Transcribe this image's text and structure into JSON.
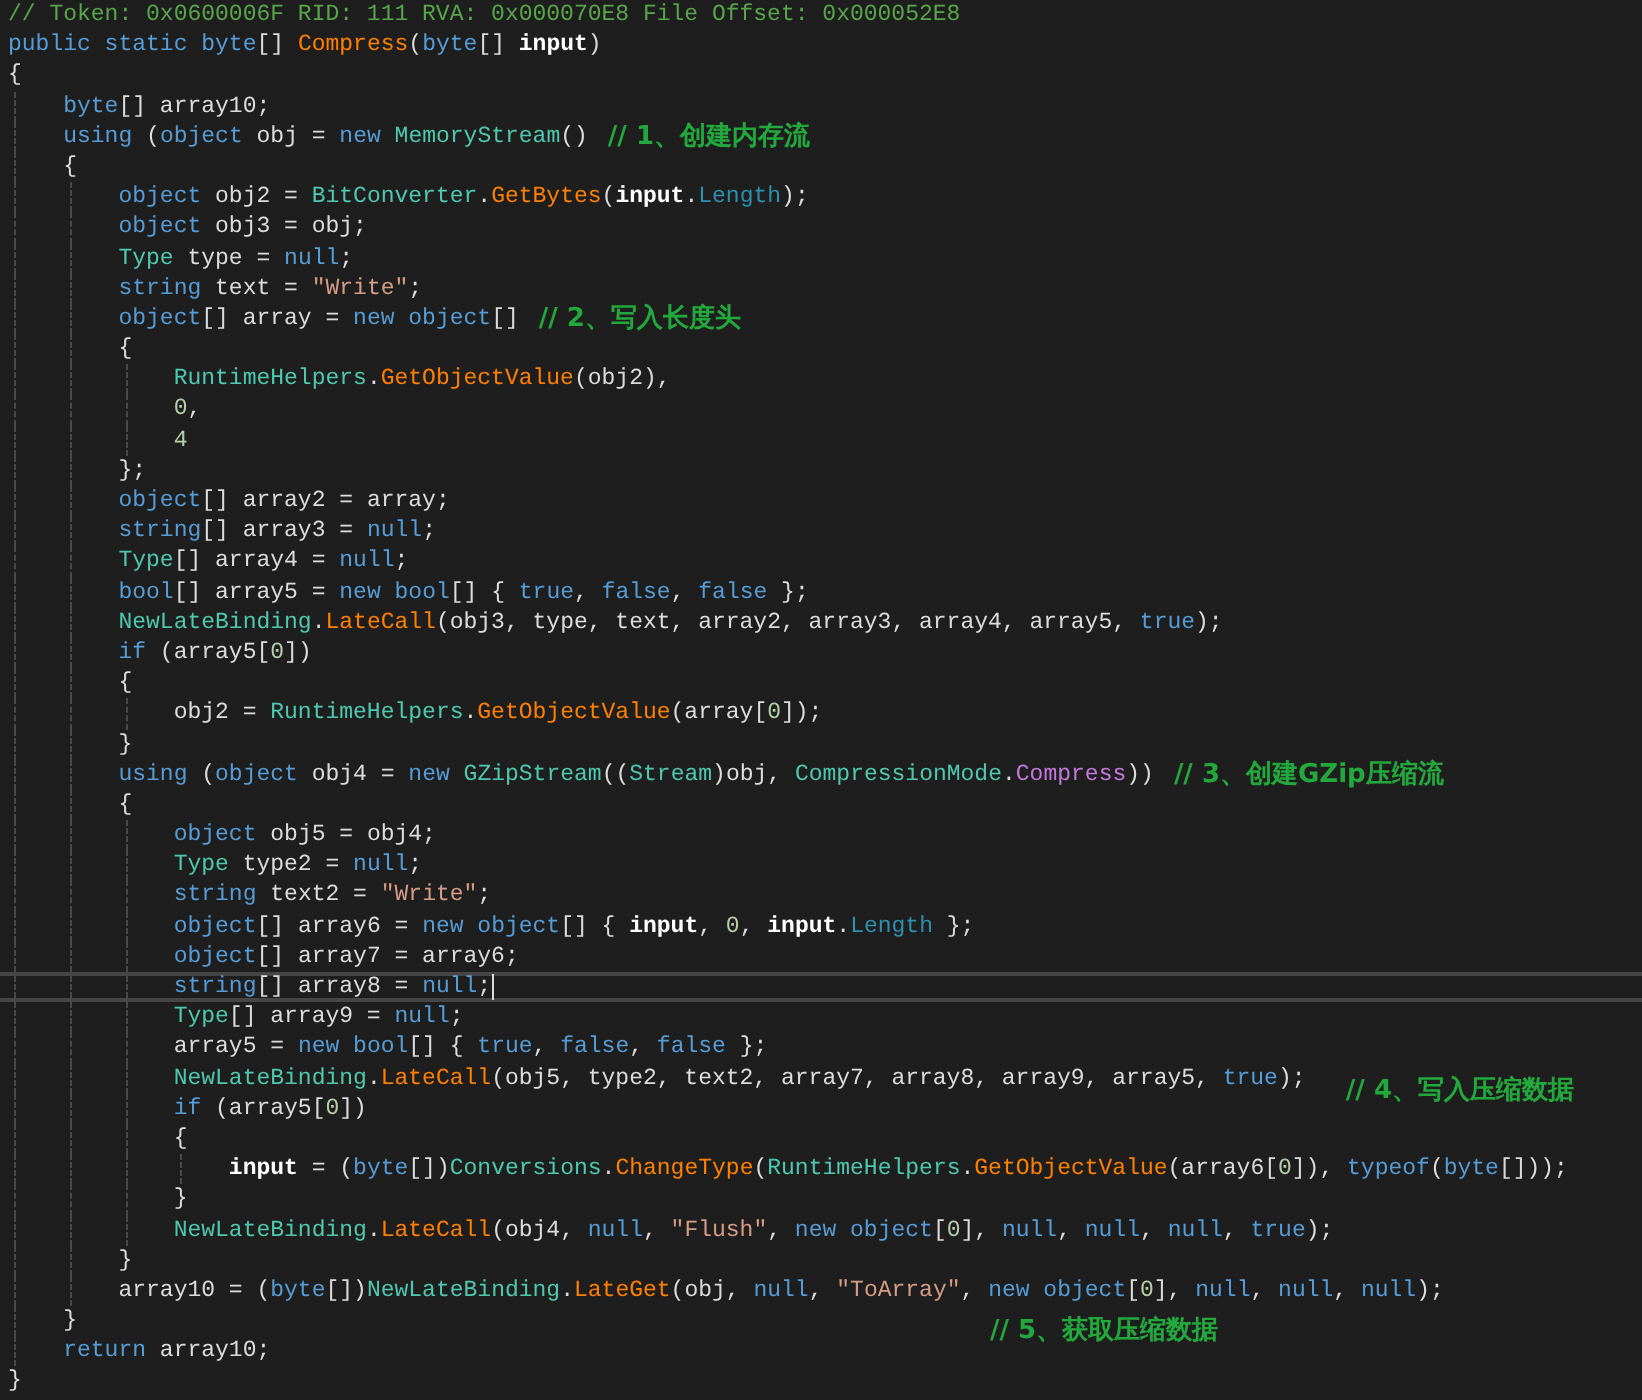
{
  "editor": {
    "lines": [
      {
        "current": false,
        "tokens": [
          {
            "kind": "comment",
            "text": "// Token: 0x0600006F RID: 111 RVA: 0x000070E8 File Offset: 0x000052E8"
          }
        ]
      },
      {
        "current": false,
        "tokens": [
          {
            "kind": "keyword",
            "text": "public static byte"
          },
          {
            "kind": "plain",
            "text": "[] "
          },
          {
            "kind": "method",
            "text": "Compress"
          },
          {
            "kind": "plain",
            "text": "("
          },
          {
            "kind": "keyword",
            "text": "byte"
          },
          {
            "kind": "plain",
            "text": "[] "
          },
          {
            "kind": "param",
            "text": "input"
          },
          {
            "kind": "plain",
            "text": ")"
          }
        ]
      },
      {
        "current": false,
        "tokens": [
          {
            "kind": "plain",
            "text": "{"
          }
        ]
      },
      {
        "current": false,
        "tokens": [
          {
            "kind": "keyword",
            "text": "    byte"
          },
          {
            "kind": "plain",
            "text": "[] array10;"
          }
        ]
      },
      {
        "current": false,
        "tokens": [
          {
            "kind": "keyword",
            "text": "    using"
          },
          {
            "kind": "plain",
            "text": " ("
          },
          {
            "kind": "keyword",
            "text": "object"
          },
          {
            "kind": "plain",
            "text": " obj = "
          },
          {
            "kind": "keyword",
            "text": "new"
          },
          {
            "kind": "type",
            "text": " MemoryStream"
          },
          {
            "kind": "plain",
            "text": "()"
          }
        ],
        "note": {
          "text": "// 1、创建内存流",
          "kind": "inline"
        }
      },
      {
        "current": false,
        "tokens": [
          {
            "kind": "plain",
            "text": "    {"
          }
        ]
      },
      {
        "current": false,
        "tokens": [
          {
            "kind": "keyword",
            "text": "        object"
          },
          {
            "kind": "plain",
            "text": " obj2 = "
          },
          {
            "kind": "type",
            "text": "BitConverter"
          },
          {
            "kind": "plain",
            "text": "."
          },
          {
            "kind": "method",
            "text": "GetBytes"
          },
          {
            "kind": "plain",
            "text": "("
          },
          {
            "kind": "param",
            "text": "input"
          },
          {
            "kind": "plain",
            "text": "."
          },
          {
            "kind": "member",
            "text": "Length"
          },
          {
            "kind": "plain",
            "text": ");"
          }
        ]
      },
      {
        "current": false,
        "tokens": [
          {
            "kind": "keyword",
            "text": "        object"
          },
          {
            "kind": "plain",
            "text": " obj3 = obj;"
          }
        ]
      },
      {
        "current": false,
        "tokens": [
          {
            "kind": "type",
            "text": "        Type"
          },
          {
            "kind": "plain",
            "text": " type = "
          },
          {
            "kind": "keyword",
            "text": "null"
          },
          {
            "kind": "plain",
            "text": ";"
          }
        ]
      },
      {
        "current": false,
        "tokens": [
          {
            "kind": "keyword",
            "text": "        string"
          },
          {
            "kind": "plain",
            "text": " text = "
          },
          {
            "kind": "string",
            "text": "\"Write\""
          },
          {
            "kind": "plain",
            "text": ";"
          }
        ]
      },
      {
        "current": false,
        "tokens": [
          {
            "kind": "keyword",
            "text": "        object"
          },
          {
            "kind": "plain",
            "text": "[] array = "
          },
          {
            "kind": "keyword",
            "text": "new object"
          },
          {
            "kind": "plain",
            "text": "[]"
          }
        ],
        "note": {
          "text": "// 2、写入长度头",
          "kind": "inline"
        }
      },
      {
        "current": false,
        "tokens": [
          {
            "kind": "plain",
            "text": "        {"
          }
        ]
      },
      {
        "current": false,
        "tokens": [
          {
            "kind": "type",
            "text": "            RuntimeHelpers"
          },
          {
            "kind": "plain",
            "text": "."
          },
          {
            "kind": "method",
            "text": "GetObjectValue"
          },
          {
            "kind": "plain",
            "text": "(obj2),"
          }
        ]
      },
      {
        "current": false,
        "tokens": [
          {
            "kind": "number",
            "text": "            0"
          },
          {
            "kind": "plain",
            "text": ","
          }
        ]
      },
      {
        "current": false,
        "tokens": [
          {
            "kind": "number",
            "text": "            4"
          }
        ]
      },
      {
        "current": false,
        "tokens": [
          {
            "kind": "plain",
            "text": "        };"
          }
        ]
      },
      {
        "current": false,
        "tokens": [
          {
            "kind": "keyword",
            "text": "        object"
          },
          {
            "kind": "plain",
            "text": "[] array2 = array;"
          }
        ]
      },
      {
        "current": false,
        "tokens": [
          {
            "kind": "keyword",
            "text": "        string"
          },
          {
            "kind": "plain",
            "text": "[] array3 = "
          },
          {
            "kind": "keyword",
            "text": "null"
          },
          {
            "kind": "plain",
            "text": ";"
          }
        ]
      },
      {
        "current": false,
        "tokens": [
          {
            "kind": "type",
            "text": "        Type"
          },
          {
            "kind": "plain",
            "text": "[] array4 = "
          },
          {
            "kind": "keyword",
            "text": "null"
          },
          {
            "kind": "plain",
            "text": ";"
          }
        ]
      },
      {
        "current": false,
        "tokens": [
          {
            "kind": "keyword",
            "text": "        bool"
          },
          {
            "kind": "plain",
            "text": "[] array5 = "
          },
          {
            "kind": "keyword",
            "text": "new bool"
          },
          {
            "kind": "plain",
            "text": "[] { "
          },
          {
            "kind": "keyword",
            "text": "true"
          },
          {
            "kind": "plain",
            "text": ", "
          },
          {
            "kind": "keyword",
            "text": "false"
          },
          {
            "kind": "plain",
            "text": ", "
          },
          {
            "kind": "keyword",
            "text": "false"
          },
          {
            "kind": "plain",
            "text": " };"
          }
        ]
      },
      {
        "current": false,
        "tokens": [
          {
            "kind": "type",
            "text": "        NewLateBinding"
          },
          {
            "kind": "plain",
            "text": "."
          },
          {
            "kind": "method",
            "text": "LateCall"
          },
          {
            "kind": "plain",
            "text": "(obj3, type, text, array2, array3, array4, array5, "
          },
          {
            "kind": "keyword",
            "text": "true"
          },
          {
            "kind": "plain",
            "text": ");"
          }
        ]
      },
      {
        "current": false,
        "tokens": [
          {
            "kind": "keyword",
            "text": "        if"
          },
          {
            "kind": "plain",
            "text": " (array5["
          },
          {
            "kind": "number",
            "text": "0"
          },
          {
            "kind": "plain",
            "text": "])"
          }
        ]
      },
      {
        "current": false,
        "tokens": [
          {
            "kind": "plain",
            "text": "        {"
          }
        ]
      },
      {
        "current": false,
        "tokens": [
          {
            "kind": "plain",
            "text": "            obj2 = "
          },
          {
            "kind": "type",
            "text": "RuntimeHelpers"
          },
          {
            "kind": "plain",
            "text": "."
          },
          {
            "kind": "method",
            "text": "GetObjectValue"
          },
          {
            "kind": "plain",
            "text": "(array["
          },
          {
            "kind": "number",
            "text": "0"
          },
          {
            "kind": "plain",
            "text": "]);"
          }
        ]
      },
      {
        "current": false,
        "tokens": [
          {
            "kind": "plain",
            "text": "        }"
          }
        ]
      },
      {
        "current": false,
        "tokens": [
          {
            "kind": "keyword",
            "text": "        using"
          },
          {
            "kind": "plain",
            "text": " ("
          },
          {
            "kind": "keyword",
            "text": "object"
          },
          {
            "kind": "plain",
            "text": " obj4 = "
          },
          {
            "kind": "keyword",
            "text": "new"
          },
          {
            "kind": "type",
            "text": " GZipStream"
          },
          {
            "kind": "plain",
            "text": "(("
          },
          {
            "kind": "type",
            "text": "Stream"
          },
          {
            "kind": "plain",
            "text": ")obj, "
          },
          {
            "kind": "type",
            "text": "CompressionMode"
          },
          {
            "kind": "plain",
            "text": "."
          },
          {
            "kind": "enum",
            "text": "Compress"
          },
          {
            "kind": "plain",
            "text": "))"
          }
        ],
        "note": {
          "text": "// 3、创建GZip压缩流",
          "kind": "inline"
        }
      },
      {
        "current": false,
        "tokens": [
          {
            "kind": "plain",
            "text": "        {"
          }
        ]
      },
      {
        "current": false,
        "tokens": [
          {
            "kind": "keyword",
            "text": "            object"
          },
          {
            "kind": "plain",
            "text": " obj5 = obj4;"
          }
        ]
      },
      {
        "current": false,
        "tokens": [
          {
            "kind": "type",
            "text": "            Type"
          },
          {
            "kind": "plain",
            "text": " type2 = "
          },
          {
            "kind": "keyword",
            "text": "null"
          },
          {
            "kind": "plain",
            "text": ";"
          }
        ]
      },
      {
        "current": false,
        "tokens": [
          {
            "kind": "keyword",
            "text": "            string"
          },
          {
            "kind": "plain",
            "text": " text2 = "
          },
          {
            "kind": "string",
            "text": "\"Write\""
          },
          {
            "kind": "plain",
            "text": ";"
          }
        ]
      },
      {
        "current": false,
        "tokens": [
          {
            "kind": "keyword",
            "text": "            object"
          },
          {
            "kind": "plain",
            "text": "[] array6 = "
          },
          {
            "kind": "keyword",
            "text": "new object"
          },
          {
            "kind": "plain",
            "text": "[] { "
          },
          {
            "kind": "param",
            "text": "input"
          },
          {
            "kind": "plain",
            "text": ", "
          },
          {
            "kind": "number",
            "text": "0"
          },
          {
            "kind": "plain",
            "text": ", "
          },
          {
            "kind": "param",
            "text": "input"
          },
          {
            "kind": "plain",
            "text": "."
          },
          {
            "kind": "member",
            "text": "Length"
          },
          {
            "kind": "plain",
            "text": " };"
          }
        ]
      },
      {
        "current": false,
        "tokens": [
          {
            "kind": "keyword",
            "text": "            object"
          },
          {
            "kind": "plain",
            "text": "[] array7 = array6;"
          }
        ]
      },
      {
        "current": true,
        "tokens": [
          {
            "kind": "keyword",
            "text": "            string"
          },
          {
            "kind": "plain",
            "text": "[] array8 = "
          },
          {
            "kind": "keyword",
            "text": "null"
          },
          {
            "kind": "plain",
            "text": ";"
          }
        ]
      },
      {
        "current": false,
        "tokens": [
          {
            "kind": "type",
            "text": "            Type"
          },
          {
            "kind": "plain",
            "text": "[] array9 = "
          },
          {
            "kind": "keyword",
            "text": "null"
          },
          {
            "kind": "plain",
            "text": ";"
          }
        ]
      },
      {
        "current": false,
        "tokens": [
          {
            "kind": "plain",
            "text": "            array5 = "
          },
          {
            "kind": "keyword",
            "text": "new bool"
          },
          {
            "kind": "plain",
            "text": "[] { "
          },
          {
            "kind": "keyword",
            "text": "true"
          },
          {
            "kind": "plain",
            "text": ", "
          },
          {
            "kind": "keyword",
            "text": "false"
          },
          {
            "kind": "plain",
            "text": ", "
          },
          {
            "kind": "keyword",
            "text": "false"
          },
          {
            "kind": "plain",
            "text": " };"
          }
        ]
      },
      {
        "current": false,
        "tokens": [
          {
            "kind": "type",
            "text": "            NewLateBinding"
          },
          {
            "kind": "plain",
            "text": "."
          },
          {
            "kind": "method",
            "text": "LateCall"
          },
          {
            "kind": "plain",
            "text": "(obj5, type2, text2, array7, array8, array9, array5, "
          },
          {
            "kind": "keyword",
            "text": "true"
          },
          {
            "kind": "plain",
            "text": ");"
          }
        ],
        "note": {
          "text": "// 4、写入压缩数据",
          "kind": "right"
        }
      },
      {
        "current": false,
        "tokens": [
          {
            "kind": "keyword",
            "text": "            if"
          },
          {
            "kind": "plain",
            "text": " (array5["
          },
          {
            "kind": "number",
            "text": "0"
          },
          {
            "kind": "plain",
            "text": "])"
          }
        ]
      },
      {
        "current": false,
        "tokens": [
          {
            "kind": "plain",
            "text": "            {"
          }
        ]
      },
      {
        "current": false,
        "tokens": [
          {
            "kind": "param",
            "text": "                input"
          },
          {
            "kind": "plain",
            "text": " = ("
          },
          {
            "kind": "keyword",
            "text": "byte"
          },
          {
            "kind": "plain",
            "text": "[])"
          },
          {
            "kind": "type",
            "text": "Conversions"
          },
          {
            "kind": "plain",
            "text": "."
          },
          {
            "kind": "method",
            "text": "ChangeType"
          },
          {
            "kind": "plain",
            "text": "("
          },
          {
            "kind": "type",
            "text": "RuntimeHelpers"
          },
          {
            "kind": "plain",
            "text": "."
          },
          {
            "kind": "method",
            "text": "GetObjectValue"
          },
          {
            "kind": "plain",
            "text": "(array6["
          },
          {
            "kind": "number",
            "text": "0"
          },
          {
            "kind": "plain",
            "text": "]), "
          },
          {
            "kind": "keyword",
            "text": "typeof"
          },
          {
            "kind": "plain",
            "text": "("
          },
          {
            "kind": "keyword",
            "text": "byte"
          },
          {
            "kind": "plain",
            "text": "[]));"
          }
        ]
      },
      {
        "current": false,
        "tokens": [
          {
            "kind": "plain",
            "text": "            }"
          }
        ]
      },
      {
        "current": false,
        "tokens": [
          {
            "kind": "type",
            "text": "            NewLateBinding"
          },
          {
            "kind": "plain",
            "text": "."
          },
          {
            "kind": "method",
            "text": "LateCall"
          },
          {
            "kind": "plain",
            "text": "(obj4, "
          },
          {
            "kind": "keyword",
            "text": "null"
          },
          {
            "kind": "plain",
            "text": ", "
          },
          {
            "kind": "string",
            "text": "\"Flush\""
          },
          {
            "kind": "plain",
            "text": ", "
          },
          {
            "kind": "keyword",
            "text": "new object"
          },
          {
            "kind": "plain",
            "text": "["
          },
          {
            "kind": "number",
            "text": "0"
          },
          {
            "kind": "plain",
            "text": "], "
          },
          {
            "kind": "keyword",
            "text": "null"
          },
          {
            "kind": "plain",
            "text": ", "
          },
          {
            "kind": "keyword",
            "text": "null"
          },
          {
            "kind": "plain",
            "text": ", "
          },
          {
            "kind": "keyword",
            "text": "null"
          },
          {
            "kind": "plain",
            "text": ", "
          },
          {
            "kind": "keyword",
            "text": "true"
          },
          {
            "kind": "plain",
            "text": ");"
          }
        ]
      },
      {
        "current": false,
        "tokens": [
          {
            "kind": "plain",
            "text": "        }"
          }
        ]
      },
      {
        "current": false,
        "tokens": [
          {
            "kind": "plain",
            "text": "        array10 = ("
          },
          {
            "kind": "keyword",
            "text": "byte"
          },
          {
            "kind": "plain",
            "text": "[])"
          },
          {
            "kind": "type",
            "text": "NewLateBinding"
          },
          {
            "kind": "plain",
            "text": "."
          },
          {
            "kind": "method",
            "text": "LateGet"
          },
          {
            "kind": "plain",
            "text": "(obj, "
          },
          {
            "kind": "keyword",
            "text": "null"
          },
          {
            "kind": "plain",
            "text": ", "
          },
          {
            "kind": "string",
            "text": "\"ToArray\""
          },
          {
            "kind": "plain",
            "text": ", "
          },
          {
            "kind": "keyword",
            "text": "new object"
          },
          {
            "kind": "plain",
            "text": "["
          },
          {
            "kind": "number",
            "text": "0"
          },
          {
            "kind": "plain",
            "text": "], "
          },
          {
            "kind": "keyword",
            "text": "null"
          },
          {
            "kind": "plain",
            "text": ", "
          },
          {
            "kind": "keyword",
            "text": "null"
          },
          {
            "kind": "plain",
            "text": ", "
          },
          {
            "kind": "keyword",
            "text": "null"
          },
          {
            "kind": "plain",
            "text": ");"
          }
        ]
      },
      {
        "current": false,
        "tokens": [
          {
            "kind": "plain",
            "text": "    }"
          }
        ]
      },
      {
        "current": false,
        "tokens": [
          {
            "kind": "keyword",
            "text": "    return"
          },
          {
            "kind": "plain",
            "text": " array10;"
          }
        ],
        "note": {
          "text": "// 5、获取压缩数据",
          "kind": "middle"
        }
      },
      {
        "current": false,
        "tokens": [
          {
            "kind": "plain",
            "text": "}"
          }
        ]
      }
    ]
  }
}
